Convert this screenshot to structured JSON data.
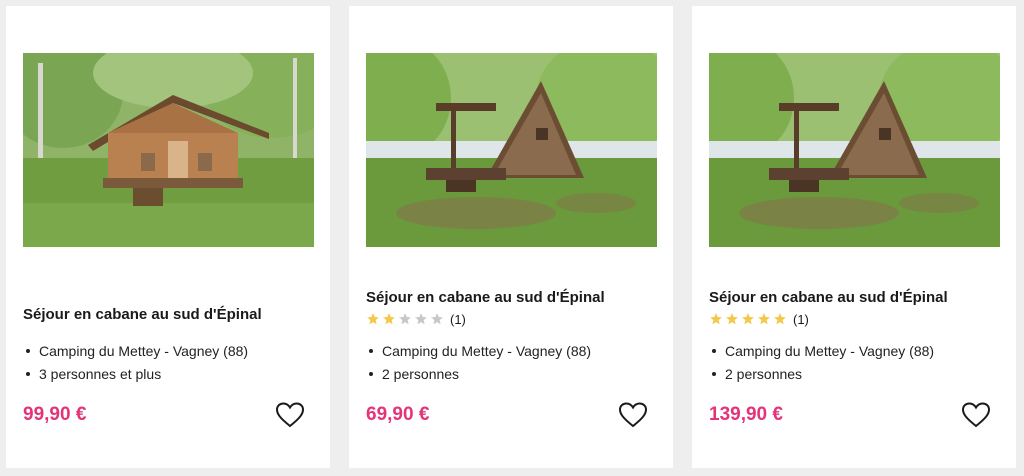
{
  "cards": [
    {
      "title": "Séjour en cabane au sud d'Épinal",
      "features": [
        "Camping du Mettey - Vagney (88)",
        "3 personnes et plus"
      ],
      "price": "99,90 €",
      "image": "wooden-chalet-photo"
    },
    {
      "title": "Séjour en cabane au sud d'Épinal",
      "rating": {
        "stars": 2,
        "max": 5,
        "count": "(1)"
      },
      "features": [
        "Camping du Mettey - Vagney (88)",
        "2 personnes"
      ],
      "price": "69,90 €",
      "image": "a-frame-cabin-photo"
    },
    {
      "title": "Séjour en cabane au sud d'Épinal",
      "rating": {
        "stars": 5,
        "max": 5,
        "count": "(1)"
      },
      "features": [
        "Camping du Mettey - Vagney (88)",
        "2 personnes"
      ],
      "price": "139,90 €",
      "image": "a-frame-cabin-photo"
    }
  ],
  "colors": {
    "price": "#e5337a",
    "star_filled": "#f2c94c",
    "star_empty": "#c8c8c8",
    "background": "#eeeeee",
    "card": "#ffffff"
  },
  "icons": {
    "favorite": "heart-outline-icon",
    "rating": "star-icon"
  }
}
